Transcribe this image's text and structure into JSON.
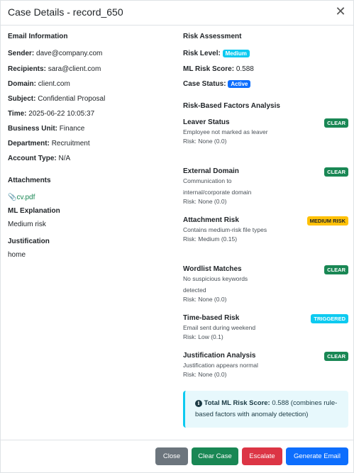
{
  "header": {
    "title": "Case Details - record_650"
  },
  "email_info": {
    "section_title": "Email Information",
    "sender_label": "Sender:",
    "sender": "dave@company.com",
    "recipients_label": "Recipients:",
    "recipients": "sara@client.com",
    "domain_label": "Domain:",
    "domain": "client.com",
    "subject_label": "Subject:",
    "subject": "Confidential Proposal",
    "time_label": "Time:",
    "time": "2025-06-22 10:05:37",
    "business_unit_label": "Business Unit:",
    "business_unit": "Finance",
    "department_label": "Department:",
    "department": "Recruitment",
    "account_type_label": "Account Type:",
    "account_type": "N/A"
  },
  "attachments": {
    "title": "Attachments",
    "file": "cv.pdf"
  },
  "ml_explanation": {
    "title": "ML Explanation",
    "text": "Medium risk"
  },
  "justification": {
    "title": "Justification",
    "text": "home"
  },
  "risk_assessment": {
    "section_title": "Risk Assessment",
    "risk_level_label": "Risk Level:",
    "risk_level": "Medium",
    "ml_score_label": "ML Risk Score:",
    "ml_score": "0.588",
    "case_status_label": "Case Status:",
    "case_status": "Active"
  },
  "factors_title": "Risk-Based Factors Analysis",
  "factors": [
    {
      "title": "Leaver Status",
      "badge": "CLEAR",
      "desc": "Employee not marked as leaver",
      "risk": "Risk: None (0.0)"
    },
    {
      "title": "External Domain",
      "badge": "CLEAR",
      "desc": "Communication to internal/corporate domain",
      "risk": "Risk: None (0.0)"
    },
    {
      "title": "Attachment Risk",
      "badge": "MEDIUM RISK",
      "desc": "Contains medium-risk file types",
      "risk": "Risk: Medium (0.15)"
    },
    {
      "title": "Wordlist Matches",
      "badge": "CLEAR",
      "desc": "No suspicious keywords detected",
      "risk": "Risk: None (0.0)"
    },
    {
      "title": "Time-based Risk",
      "badge": "TRIGGERED",
      "desc": "Email sent during weekend",
      "risk": "Risk: Low (0.1)"
    },
    {
      "title": "Justification Analysis",
      "badge": "CLEAR",
      "desc": "Justification appears normal",
      "risk": "Risk: None (0.0)"
    }
  ],
  "summary": {
    "label": "Total ML Risk Score:",
    "value": "0.588",
    "note": "(combines rule-based factors with anomaly detection)"
  },
  "footer": {
    "close": "Close",
    "clear_case": "Clear Case",
    "escalate": "Escalate",
    "generate_email": "Generate Email"
  },
  "colors": {
    "green": "#198754",
    "yellow": "#ffc107",
    "cyan": "#0dcaf0",
    "blue": "#0d6efd",
    "red": "#dc3545",
    "gray": "#6c757d"
  }
}
